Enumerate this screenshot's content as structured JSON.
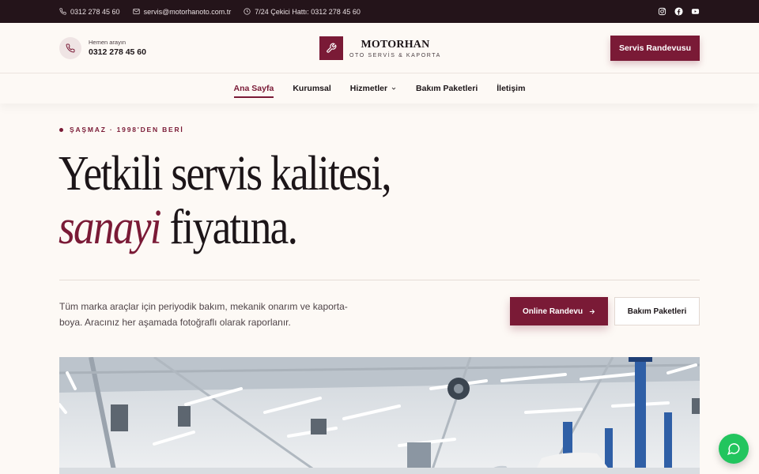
{
  "topbar": {
    "phone": "0312 278 45 60",
    "email": "servis@motorhanoto.com.tr",
    "hotline": "7/24 Çekici Hattı: 0312 278 45 60",
    "social": [
      "instagram-icon",
      "facebook-icon",
      "youtube-icon"
    ]
  },
  "header": {
    "call_label": "Hemen arayın",
    "call_number": "0312 278 45 60",
    "logo_title": "MOTORHAN",
    "logo_subtitle": "OTO SERVİS & KAPORTA",
    "cta": "Servis Randevusu"
  },
  "nav": {
    "items": [
      {
        "label": "Ana Sayfa",
        "active": true
      },
      {
        "label": "Kurumsal"
      },
      {
        "label": "Hizmetler",
        "dropdown": true
      },
      {
        "label": "Bakım Paketleri"
      },
      {
        "label": "İletişim"
      }
    ]
  },
  "hero": {
    "eyebrow": "ŞAŞMAZ · 1998'DEN BERİ",
    "headline_line1": "Yetkili servis kalitesi,",
    "headline_accent": "sanayi",
    "headline_rest": " fiyatına.",
    "lead": "Tüm marka araçlar için periyodik bakım, mekanik onarım ve kaporta-boya. Aracınız her aşamada fotoğraflı olarak raporlanır.",
    "primary_button": "Online Randevu",
    "secondary_button": "Bakım Paketleri"
  },
  "colors": {
    "brand": "#7a1a36",
    "topbar_bg": "#24141a",
    "page_bg": "#fdf9f5",
    "chat": "#22c55e"
  }
}
